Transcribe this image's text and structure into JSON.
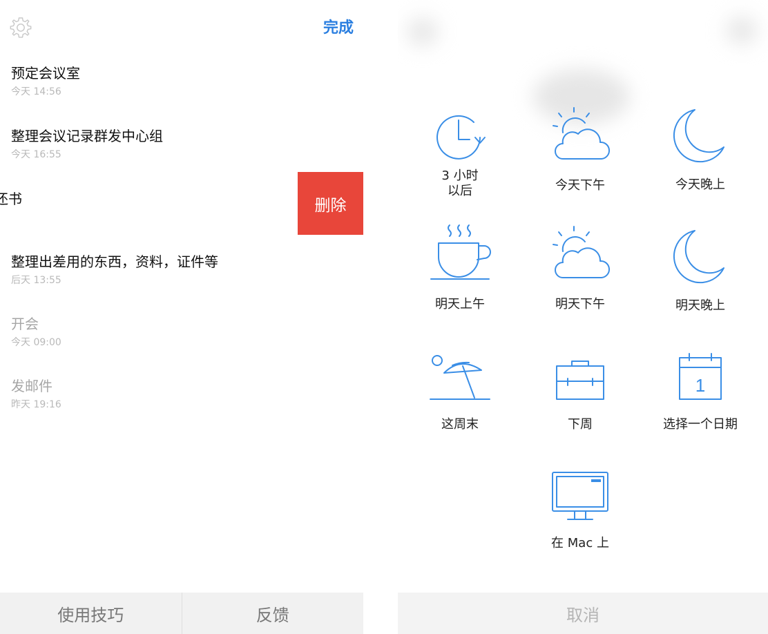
{
  "header": {
    "done_label": "完成"
  },
  "tasks": [
    {
      "title": "预定会议室",
      "time": "今天 14:56"
    },
    {
      "title": "整理会议记录群发中心组",
      "time": "今天 16:55"
    },
    {
      "title": "整理出差用的东西，资料，证件等",
      "time": "后天 13:55"
    },
    {
      "title": "开会",
      "time": "今天 09:00"
    },
    {
      "title": "发邮件",
      "time": "昨天 19:16"
    }
  ],
  "swiped_task": {
    "title": "还书",
    "delete_label": "删除"
  },
  "bottom_bar": {
    "tips_label": "使用技巧",
    "feedback_label": "反馈"
  },
  "snooze": {
    "options": [
      {
        "label": "3 小时\n以后",
        "icon": "clock-arrow-icon"
      },
      {
        "label": "今天下午",
        "icon": "sun-cloud-icon"
      },
      {
        "label": "今天晚上",
        "icon": "moon-icon"
      },
      {
        "label": "明天上午",
        "icon": "coffee-cup-icon"
      },
      {
        "label": "明天下午",
        "icon": "sun-cloud-icon"
      },
      {
        "label": "明天晚上",
        "icon": "moon-icon"
      },
      {
        "label": "这周末",
        "icon": "beach-umbrella-icon"
      },
      {
        "label": "下周",
        "icon": "briefcase-icon"
      },
      {
        "label": "选择一个日期",
        "icon": "calendar-icon"
      },
      {
        "label": "在 Mac 上",
        "icon": "monitor-icon"
      }
    ],
    "cancel_label": "取消"
  },
  "colors": {
    "accent": "#2b7fe0",
    "delete": "#e8463a",
    "icon": "#3a8ee6"
  }
}
